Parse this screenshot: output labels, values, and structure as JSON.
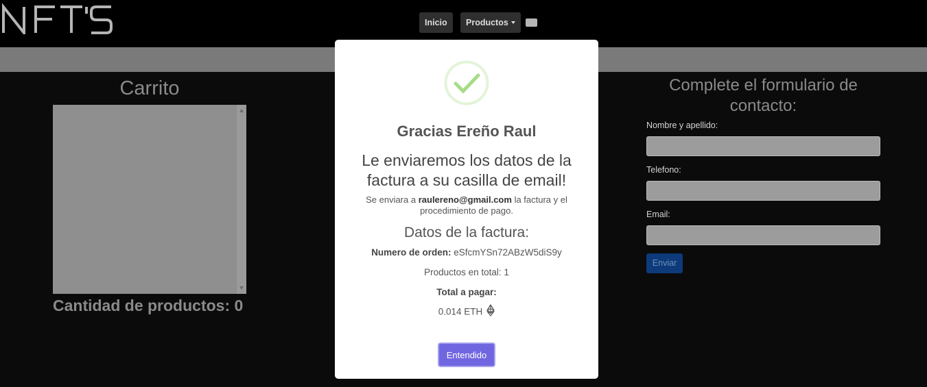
{
  "navbar": {
    "brand": "NFT'S",
    "items": [
      {
        "label": "Inicio"
      },
      {
        "label": "Productos"
      }
    ],
    "cart_icon": "cart-icon"
  },
  "cart": {
    "title": "Carrito",
    "count_label": "Cantidad de productos: 0"
  },
  "contact": {
    "title": "Complete el formulario de contacto:",
    "fields": [
      {
        "label": "Nombre y apellido:",
        "value": ""
      },
      {
        "label": "Telefono:",
        "value": ""
      },
      {
        "label": "Email:",
        "value": ""
      }
    ],
    "submit_label": "Enviar"
  },
  "modal": {
    "icon": "success-check-icon",
    "title": "Gracias Ereño Raul",
    "subtitle": "Le enviaremos los datos de la factura a su casilla de email!",
    "note_prefix": "Se enviara a",
    "email": "raulereno@gmail.com",
    "note_suffix": "la factura y el procedimiento de pago.",
    "section_title": "Datos de la factura:",
    "order_label": "Numero de orden:",
    "order_number": "eSfcmYSn72ABzW5diS9y",
    "products_total": "Productos en total: 1",
    "total_label": "Total a pagar:",
    "total_amount": "0.014 ETH",
    "currency_icon": "ethereum-icon",
    "button_label": "Entendido"
  },
  "colors": {
    "accent": "#7066e0",
    "success": "#a5dc86",
    "submit_button": "#0d3a7a"
  }
}
